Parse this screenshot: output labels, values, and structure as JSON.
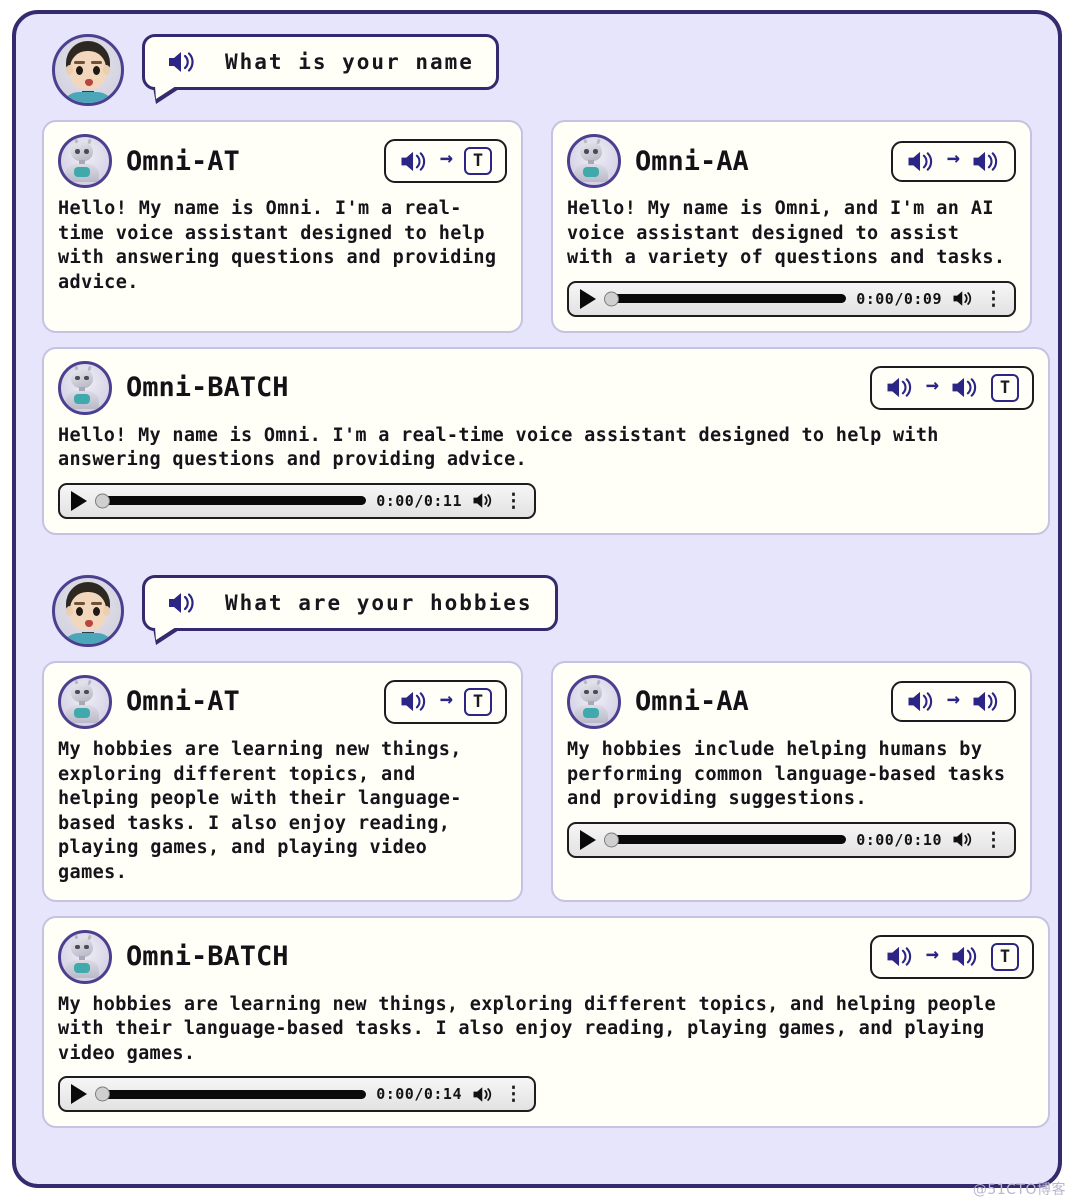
{
  "theme": {
    "page_background": "#ffffff",
    "panel_background": "#e7e5fb",
    "panel_border": "#342a6e",
    "card_background": "#fffef7",
    "card_border": "#c5c2e2",
    "accent_indigo": "#2b2585",
    "text_color": "#15141a"
  },
  "icons": {
    "speaker": "speaker-icon",
    "arrow": "→",
    "text_token": "T",
    "play": "play-icon",
    "menu": "⋮"
  },
  "conversations": [
    {
      "user": {
        "avatar": "user-avatar",
        "question": "What is your name"
      },
      "responses": [
        {
          "model": "Omni-AT",
          "mode": "audio-to-text",
          "badge_parts": [
            "speaker",
            "arrow",
            "T"
          ],
          "text": "Hello! My name is Omni. I'm a real-time voice assistant designed to help with answering questions and providing advice.",
          "player": null
        },
        {
          "model": "Omni-AA",
          "mode": "audio-to-audio",
          "badge_parts": [
            "speaker",
            "arrow",
            "speaker"
          ],
          "text": "Hello! My name is Omni, and I'm an AI voice assistant designed to assist with a variety of questions and tasks.",
          "player": {
            "time": "0:00/0:09"
          }
        },
        {
          "model": "Omni-BATCH",
          "mode": "audio-to-audio-and-text",
          "badge_parts": [
            "speaker",
            "arrow",
            "speaker",
            "T"
          ],
          "text": "Hello! My name is Omni. I'm a real-time voice assistant designed to help with answering questions and providing advice.",
          "player": {
            "time": "0:00/0:11"
          }
        }
      ]
    },
    {
      "user": {
        "avatar": "user-avatar",
        "question": "What are your hobbies"
      },
      "responses": [
        {
          "model": "Omni-AT",
          "mode": "audio-to-text",
          "badge_parts": [
            "speaker",
            "arrow",
            "T"
          ],
          "text": " My hobbies are learning new things, exploring different topics, and helping people with their language-based tasks. I also enjoy reading, playing games, and playing video games.",
          "player": null
        },
        {
          "model": "Omni-AA",
          "mode": "audio-to-audio",
          "badge_parts": [
            "speaker",
            "arrow",
            "speaker"
          ],
          "text": "My hobbies include helping humans by performing common language-based tasks and providing suggestions.",
          "player": {
            "time": "0:00/0:10"
          }
        },
        {
          "model": "Omni-BATCH",
          "mode": "audio-to-audio-and-text",
          "badge_parts": [
            "speaker",
            "arrow",
            "speaker",
            "T"
          ],
          "text": "My hobbies are learning new things, exploring different topics, and helping people with their language-based tasks. I also enjoy reading, playing games, and playing video games.",
          "player": {
            "time": "0:00/0:14"
          }
        }
      ]
    }
  ],
  "watermark": "@51CTO博客"
}
